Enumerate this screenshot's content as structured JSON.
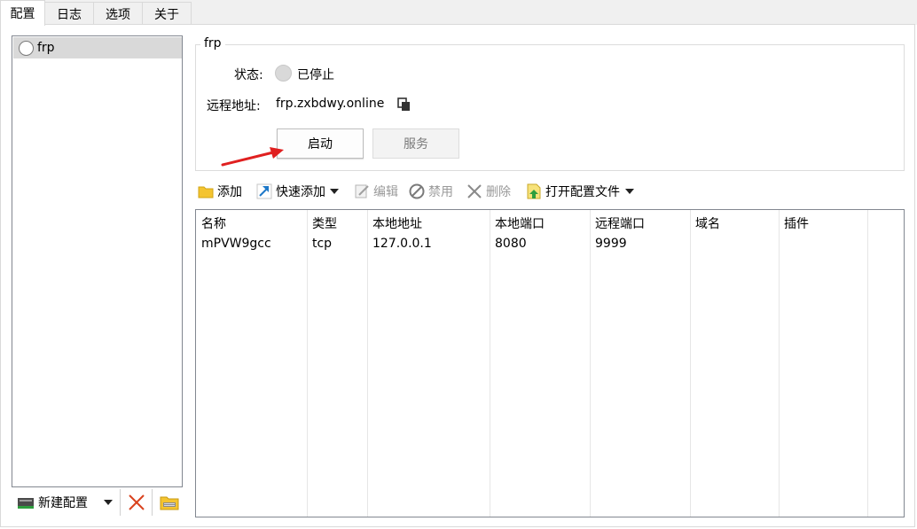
{
  "tabs": [
    {
      "label": "配置",
      "active": true
    },
    {
      "label": "日志",
      "active": false
    },
    {
      "label": "选项",
      "active": false
    },
    {
      "label": "关于",
      "active": false
    }
  ],
  "config_list": {
    "items": [
      {
        "name": "frp",
        "selected": true
      }
    ]
  },
  "left_toolbar": {
    "new_config_label": "新建配置"
  },
  "detail": {
    "group_title": "frp",
    "status_label": "状态:",
    "status_value": "已停止",
    "remote_label": "远程地址:",
    "remote_value": "frp.zxbdwy.online",
    "start_button": "启动",
    "service_button": "服务"
  },
  "toolbar": {
    "add": "添加",
    "quick_add": "快速添加",
    "edit": "编辑",
    "disable": "禁用",
    "delete": "删除",
    "open_config": "打开配置文件"
  },
  "table": {
    "columns": [
      "名称",
      "类型",
      "本地地址",
      "本地端口",
      "远程端口",
      "域名",
      "插件"
    ],
    "rows": [
      [
        "mPVW9gcc",
        "tcp",
        "127.0.0.1",
        "8080",
        "9999",
        "",
        ""
      ]
    ]
  },
  "colors": {
    "selection": "#d9d9d9",
    "border": "#828790",
    "arrow": "#e02020",
    "disabled_text": "#9a9a9a"
  }
}
